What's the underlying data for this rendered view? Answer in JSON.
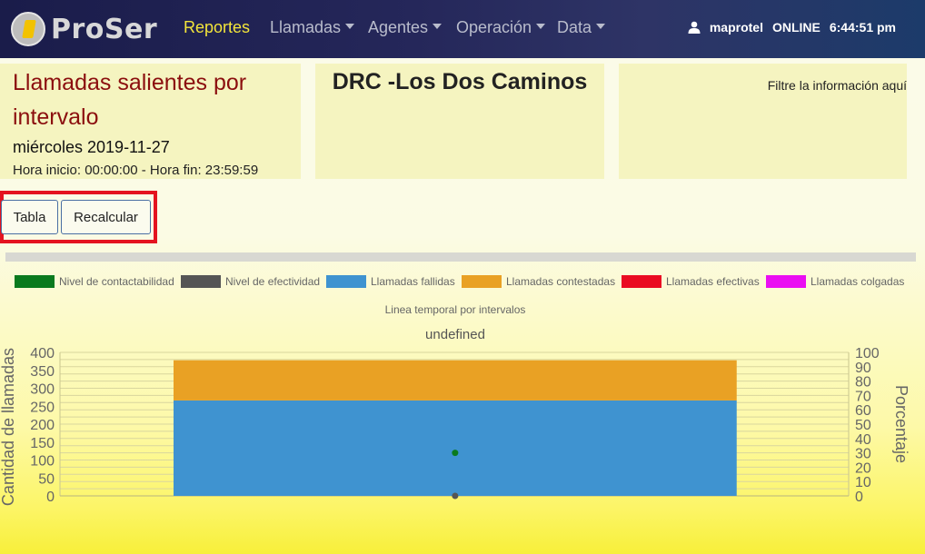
{
  "navbar": {
    "brand": "ProSer",
    "items": [
      {
        "label": "Reportes",
        "dropdown": false,
        "active": true
      },
      {
        "label": "Llamadas",
        "dropdown": true
      },
      {
        "label": "Agentes",
        "dropdown": true
      },
      {
        "label": "Operación",
        "dropdown": true
      },
      {
        "label": "Data",
        "dropdown": true
      }
    ],
    "user": "maprotel",
    "status": "ONLINE",
    "time": "6:44:51 pm",
    "user_icon": "user-icon"
  },
  "report": {
    "title": "Llamadas salientes por intervalo",
    "date": "miércoles 2019-11-27",
    "hours": "Hora inicio: 00:00:00 - Hora fin: 23:59:59",
    "site": "DRC -Los Dos Caminos",
    "filter_hint": "Filtre la información aquí"
  },
  "buttons": {
    "tabla": "Tabla",
    "recalcular": "Recalcular"
  },
  "colors": {
    "accent_red": "#e4131f",
    "title_red": "#8b0e0e",
    "nav_active": "#f3e53a"
  },
  "chart_data": {
    "type": "bar",
    "stacked": true,
    "subtitle": "Linea temporal por intervalos",
    "title": "undefined",
    "ylabel": "Cantidad de llamadas",
    "y2label": "Porcentaje",
    "ylim": [
      0,
      400
    ],
    "y2lim": [
      0,
      100
    ],
    "yticks": [
      "400",
      "350",
      "300",
      "250",
      "200",
      "150",
      "100",
      "50",
      "0"
    ],
    "y2ticks": [
      "100",
      "90",
      "80",
      "70",
      "60",
      "50",
      "40",
      "30",
      "20",
      "10",
      "0"
    ],
    "legend_position": "top",
    "categories": [
      ""
    ],
    "legend": [
      {
        "name": "Nivel de contactabilidad",
        "color": "#0a7a1e"
      },
      {
        "name": "Nivel de efectividad",
        "color": "#555555"
      },
      {
        "name": "Llamadas fallidas",
        "color": "#3f93d0"
      },
      {
        "name": "Llamadas contestadas",
        "color": "#e9a124"
      },
      {
        "name": "Llamadas efectivas",
        "color": "#ea0b22"
      },
      {
        "name": "Llamadas colgadas",
        "color": "#ea0ef2"
      }
    ],
    "bar_series": [
      {
        "name": "Llamadas fallidas",
        "values": [
          266
        ],
        "color": "#3f93d0"
      },
      {
        "name": "Llamadas contestadas",
        "values": [
          112
        ],
        "color": "#e9a124"
      },
      {
        "name": "Llamadas efectivas",
        "values": [
          0
        ],
        "color": "#ea0b22"
      },
      {
        "name": "Llamadas colgadas",
        "values": [
          0
        ],
        "color": "#ea0ef2"
      }
    ],
    "point_series": [
      {
        "name": "Nivel de contactabilidad",
        "values": [
          30
        ],
        "axis": "right",
        "color": "#0a7a1e"
      },
      {
        "name": "Nivel de efectividad",
        "values": [
          0
        ],
        "axis": "right",
        "color": "#555555"
      }
    ]
  }
}
